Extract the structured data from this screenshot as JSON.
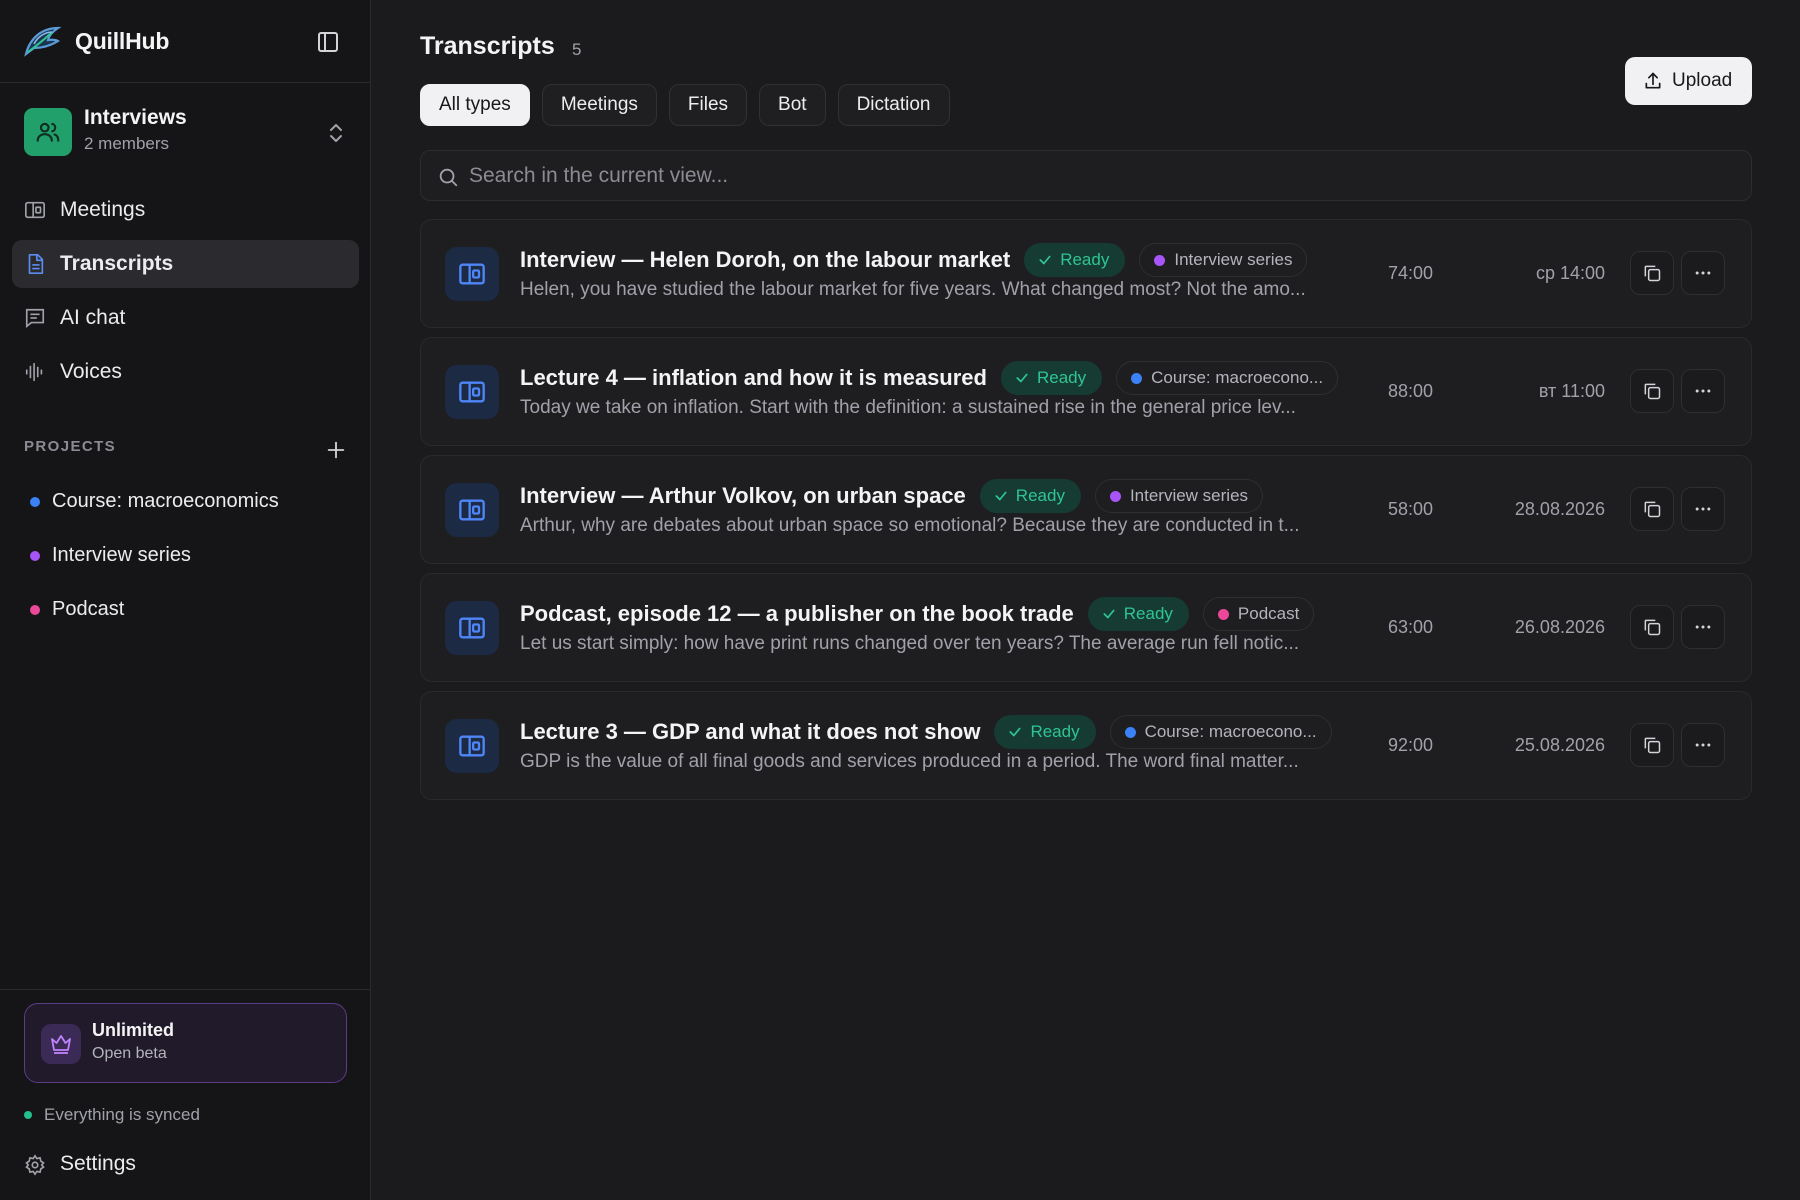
{
  "brand": {
    "name": "QuillHub"
  },
  "workspace": {
    "name": "Interviews",
    "members": "2 members",
    "color": "#22a06b"
  },
  "nav": {
    "items": [
      {
        "label": "Meetings",
        "icon": "meetings-icon",
        "active": false
      },
      {
        "label": "Transcripts",
        "icon": "document-icon",
        "active": true
      },
      {
        "label": "AI chat",
        "icon": "chat-icon",
        "active": false
      },
      {
        "label": "Voices",
        "icon": "waveform-icon",
        "active": false
      }
    ]
  },
  "projects": {
    "heading": "PROJECTS",
    "items": [
      {
        "label": "Course: macroeconomics",
        "color": "#3b82f6"
      },
      {
        "label": "Interview series",
        "color": "#a855f7"
      },
      {
        "label": "Podcast",
        "color": "#ec4899"
      }
    ]
  },
  "plan": {
    "title": "Unlimited",
    "subtitle": "Open beta"
  },
  "sync": {
    "label": "Everything is synced"
  },
  "settings": {
    "label": "Settings"
  },
  "main": {
    "title": "Transcripts",
    "count": "5",
    "upload_label": "Upload",
    "filters": [
      {
        "label": "All types",
        "active": true
      },
      {
        "label": "Meetings",
        "active": false
      },
      {
        "label": "Files",
        "active": false
      },
      {
        "label": "Bot",
        "active": false
      },
      {
        "label": "Dictation",
        "active": false
      }
    ],
    "search_placeholder": "Search in the current view..."
  },
  "transcripts": [
    {
      "title": "Interview — Helen Doroh, on the labour market",
      "status": "Ready",
      "project": "Interview series",
      "project_color": "#a855f7",
      "snippet": "Helen, you have studied the labour market for five years. What changed most? Not the amo...",
      "duration": "74:00",
      "date": "ср 14:00"
    },
    {
      "title": "Lecture 4 — inflation and how it is measured",
      "status": "Ready",
      "project": "Course: macroecono...",
      "project_color": "#3b82f6",
      "snippet": "Today we take on inflation. Start with the definition: a sustained rise in the general price lev...",
      "duration": "88:00",
      "date": "вт 11:00"
    },
    {
      "title": "Interview — Arthur Volkov, on urban space",
      "status": "Ready",
      "project": "Interview series",
      "project_color": "#a855f7",
      "snippet": "Arthur, why are debates about urban space so emotional? Because they are conducted in t...",
      "duration": "58:00",
      "date": "28.08.2026"
    },
    {
      "title": "Podcast, episode 12 — a publisher on the book trade",
      "status": "Ready",
      "project": "Podcast",
      "project_color": "#ec4899",
      "snippet": "Let us start simply: how have print runs changed over ten years? The average run fell notic...",
      "duration": "63:00",
      "date": "26.08.2026"
    },
    {
      "title": "Lecture 3 — GDP and what it does not show",
      "status": "Ready",
      "project": "Course: macroecono...",
      "project_color": "#3b82f6",
      "snippet": "GDP is the value of all final goods and services produced in a period. The word final matter...",
      "duration": "92:00",
      "date": "25.08.2026"
    }
  ]
}
